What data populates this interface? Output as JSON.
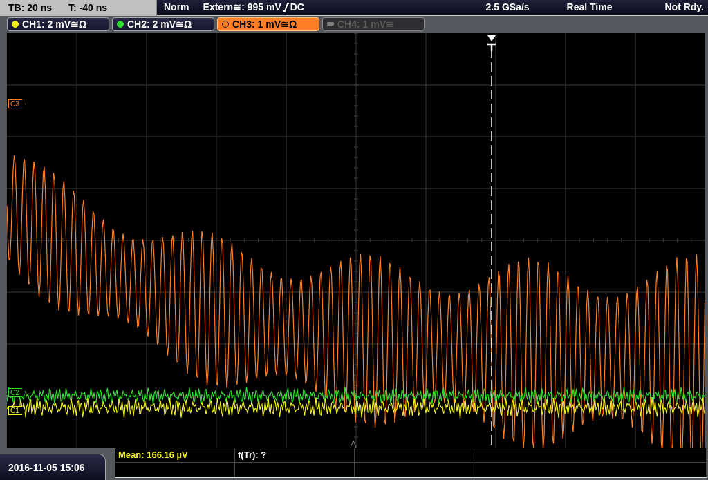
{
  "top_bar": {
    "timebase": "TB: 20 ns",
    "trigger_time": "T: -40 ns",
    "mode": "Norm",
    "trigger_source": "Extern≅: 995 mV",
    "trigger_coupling": "DC",
    "sample_rate": "2.5 GSa/s",
    "acquisition": "Real Time",
    "status": "Not Rdy."
  },
  "channels": [
    {
      "label": "CH1: 2 mV≅Ω",
      "color": "#f0f020",
      "selected": false,
      "disabled": false
    },
    {
      "label": "CH2: 2 mV≅Ω",
      "color": "#30e030",
      "selected": false,
      "disabled": false
    },
    {
      "label": "CH3: 1 mV≅Ω",
      "color": "#ff7f27",
      "selected": true,
      "disabled": false
    },
    {
      "label": "CH4: 1 mV≅",
      "color": "#808080",
      "selected": false,
      "disabled": true
    }
  ],
  "markers": [
    {
      "label": "C3",
      "color": "#ff7f27"
    },
    {
      "label": "C2",
      "color": "#30e030"
    },
    {
      "label": "C1",
      "color": "#f0f020"
    }
  ],
  "waveforms": [
    {
      "kind": "decaying",
      "color": "#ff7f27"
    },
    {
      "kind": "noise",
      "color": "#30e030"
    },
    {
      "kind": "noise",
      "color": "#f0f020"
    }
  ],
  "date": "2016-11-05 15:06",
  "measurements": [
    {
      "text": "Mean: 166.16 µV",
      "color": "#f0f020"
    },
    {
      "text": "f(Tr): ?",
      "color": "#ffffff"
    }
  ]
}
